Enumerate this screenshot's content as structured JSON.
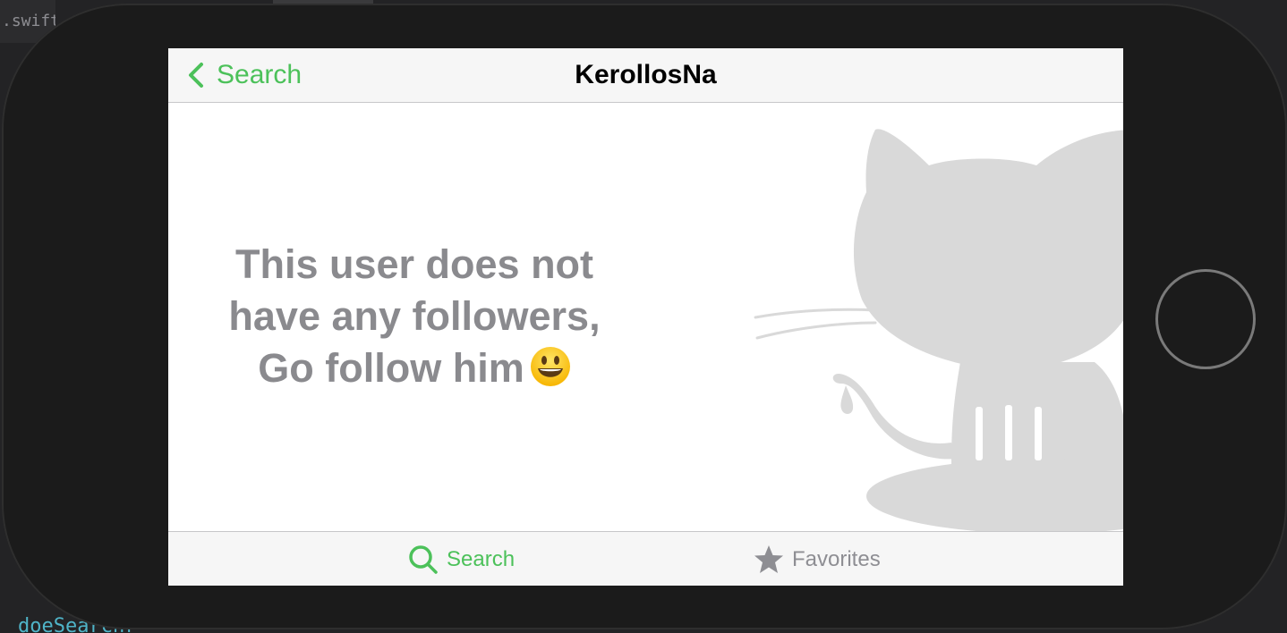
{
  "backdrop": {
    "tab_fragment": ".swift",
    "code_fragment": "doeSearchr"
  },
  "colors": {
    "accent": "#4cc15a",
    "secondary_text": "#8a8a8e",
    "logo_gray": "#d9d9d9",
    "device_frame": "#1b1b1b"
  },
  "navbar": {
    "back_label": "Search",
    "back_icon": "chevron-left-icon",
    "title": "KerollosNa"
  },
  "empty_state": {
    "line1": "This user does not",
    "line2": "have any followers,",
    "line3": "Go follow him",
    "emoji_icon": "grinning-face-emoji",
    "background_icon": "octocat-logo"
  },
  "tabbar": {
    "tabs": [
      {
        "label": "Search",
        "icon": "magnifying-glass-icon",
        "selected": true
      },
      {
        "label": "Favorites",
        "icon": "star-icon",
        "selected": false
      }
    ]
  }
}
